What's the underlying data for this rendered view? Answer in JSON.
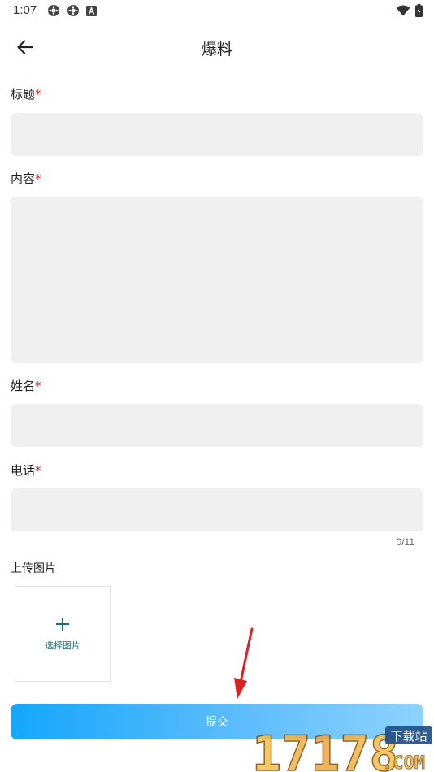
{
  "status_bar": {
    "time": "1:07",
    "left_icons": [
      "settings-gear-icon",
      "settings-gear-icon",
      "text-a-icon"
    ],
    "right_icons": [
      "wifi-icon",
      "battery-charging-icon"
    ]
  },
  "app_bar": {
    "back_icon": "arrow-left-icon",
    "title": "爆料"
  },
  "form": {
    "title_field": {
      "label": "标题",
      "required_mark": "*",
      "value": "",
      "placeholder": ""
    },
    "content_field": {
      "label": "内容",
      "required_mark": "*",
      "value": "",
      "placeholder": ""
    },
    "name_field": {
      "label": "姓名",
      "required_mark": "*",
      "value": "",
      "placeholder": ""
    },
    "phone_field": {
      "label": "电话",
      "required_mark": "*",
      "value": "",
      "placeholder": "",
      "counter": "0/11"
    },
    "upload": {
      "label": "上传图片",
      "icon": "plus-icon",
      "button_text": "选择图片"
    },
    "submit_label": "提交"
  },
  "watermark": {
    "logo_text": "17178",
    "badge_text": "下载站",
    "suffix_text": ".COM"
  },
  "colors": {
    "required": "#e02020",
    "input_bg": "#f0f0f0",
    "accent": "#1f6e6e",
    "button_gradient_start": "#14a7fb",
    "button_gradient_end": "#8cd3fd",
    "annotation_arrow": "#e02020"
  }
}
